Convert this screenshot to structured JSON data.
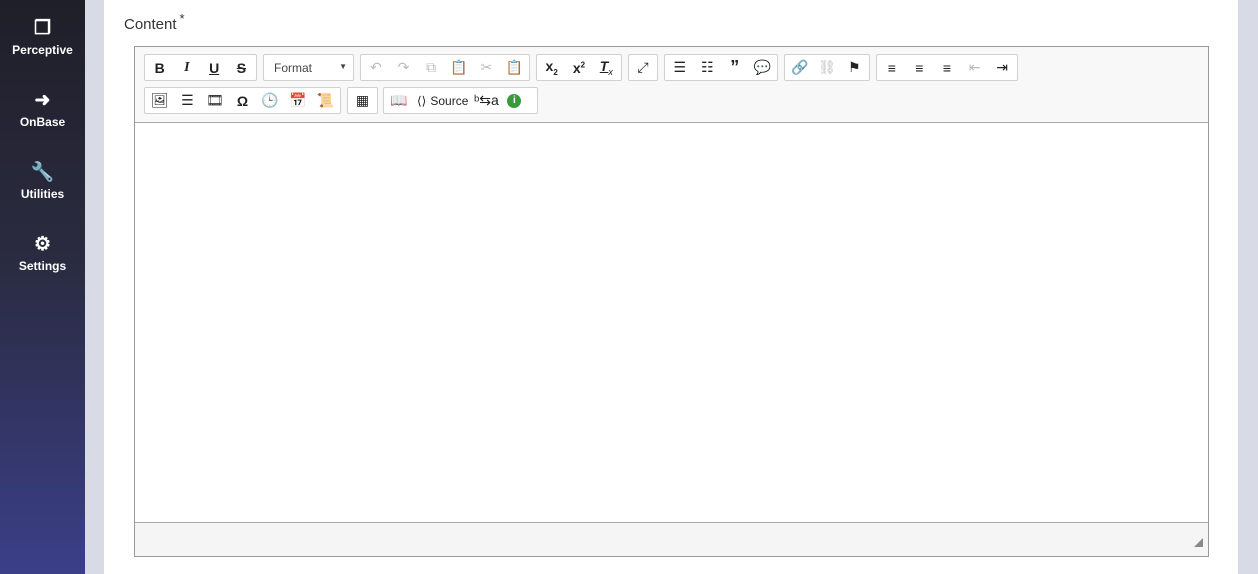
{
  "sidebar": {
    "items": [
      {
        "label": "Perceptive",
        "icon": "documents-icon"
      },
      {
        "label": "OnBase",
        "icon": "chevron-circle-icon"
      },
      {
        "label": "Utilities",
        "icon": "wrench-icon"
      },
      {
        "label": "Settings",
        "icon": "gear-icon"
      }
    ]
  },
  "field": {
    "label": "Content",
    "required": "*"
  },
  "toolbar": {
    "format_label": "Format",
    "source_label": "Source",
    "row1": [
      [
        "bold",
        "italic",
        "underline",
        "strike"
      ],
      [
        "undo",
        "redo",
        "copy",
        "paste",
        "cut",
        "paste-word"
      ],
      [
        "subscript",
        "superscript",
        "remove-format"
      ],
      [
        "maximize"
      ],
      [
        "numbered-list",
        "bulleted-list",
        "blockquote",
        "comment"
      ],
      [
        "link",
        "unlink",
        "anchor"
      ],
      [
        "align-left",
        "align-center",
        "align-right",
        "outdent",
        "indent"
      ]
    ],
    "row2": [
      [
        "image",
        "horizontal-rule",
        "video",
        "special-char",
        "clock",
        "calendar",
        "template"
      ],
      [
        "table"
      ],
      [
        "book",
        "source",
        "bidi",
        "info"
      ]
    ]
  }
}
